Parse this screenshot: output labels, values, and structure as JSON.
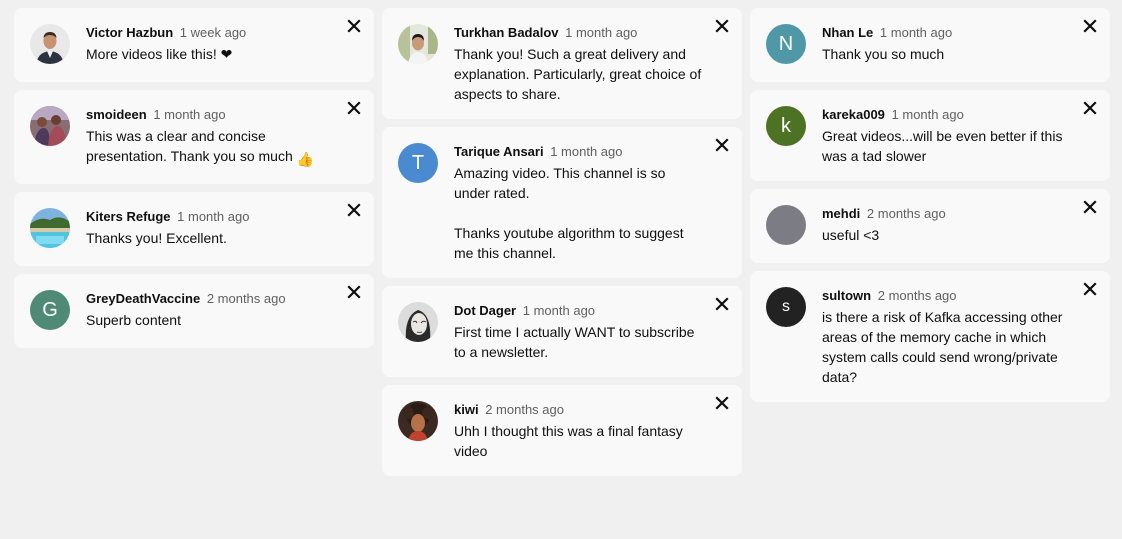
{
  "columns": [
    [
      {
        "author": "Victor Hazbun",
        "time": "1 week ago",
        "text": "More videos like this! ❤",
        "avatar": {
          "type": "photo",
          "icon": "photo-man-suit"
        }
      },
      {
        "author": "smoideen",
        "time": "1 month ago",
        "text": "This was a clear and concise presentation. Thank you so much",
        "emoji": "👍",
        "avatar": {
          "type": "photo",
          "icon": "photo-group"
        }
      },
      {
        "author": "Kiters Refuge",
        "time": "1 month ago",
        "text": "Thanks you! Excellent.",
        "avatar": {
          "type": "photo",
          "icon": "photo-pool"
        }
      },
      {
        "author": "GreyDeathVaccine",
        "time": "2 months ago",
        "text": "Superb content",
        "avatar": {
          "type": "letter",
          "letter": "G",
          "color": "#4f8a77"
        }
      }
    ],
    [
      {
        "author": "Turkhan Badalov",
        "time": "1 month ago",
        "text": "Thank you! Such a great delivery and explanation. Particularly, great choice of aspects to share.",
        "avatar": {
          "type": "photo",
          "icon": "photo-man-outdoor"
        }
      },
      {
        "author": "Tarique Ansari",
        "time": "1 month ago",
        "text": "Amazing video. This channel is so under rated.\n\nThanks youtube algorithm to suggest me this channel.",
        "avatar": {
          "type": "letter",
          "letter": "T",
          "color": "#4a8ad0"
        }
      },
      {
        "author": "Dot Dager",
        "time": "1 month ago",
        "text": "First time I actually WANT to subscribe to a newsletter.",
        "avatar": {
          "type": "photo",
          "icon": "photo-sketch-face"
        }
      },
      {
        "author": "kiwi",
        "time": "2 months ago",
        "text": "Uhh I thought this was a final fantasy video",
        "avatar": {
          "type": "photo",
          "icon": "photo-curly-hair"
        }
      }
    ],
    [
      {
        "author": "Nhan Le",
        "time": "1 month ago",
        "text": "Thank you so much",
        "avatar": {
          "type": "letter",
          "letter": "N",
          "color": "#4e98a8"
        }
      },
      {
        "author": "kareka009",
        "time": "1 month ago",
        "text": "Great videos...will be even better if this was a tad slower",
        "avatar": {
          "type": "letter",
          "letter": "k",
          "color": "#4e7223"
        }
      },
      {
        "author": "mehdi",
        "time": "2 months ago",
        "text": "useful <3",
        "avatar": {
          "type": "blank",
          "color": "#7c7c84"
        }
      },
      {
        "author": "sultown",
        "time": "2 months ago",
        "text": "is there a risk of Kafka accessing other areas of the memory cache in which system calls could send wrong/private data?",
        "avatar": {
          "type": "letter-small",
          "letter": "s",
          "color": "#222222"
        }
      }
    ]
  ],
  "icons": {
    "close": "close-icon"
  }
}
